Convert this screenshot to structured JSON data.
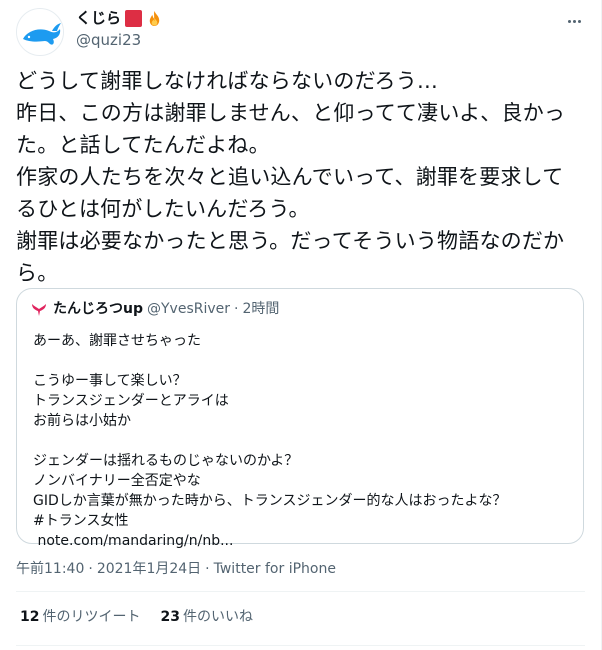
{
  "author": {
    "display_name": "くじら",
    "handle": "@quzi23"
  },
  "tweet": {
    "text": "どうして謝罪しなければならないのだろう…\n昨日、この方は謝罪しません、と仰ってて凄いよ、良かった。と話してたんだよね。\n作家の人たちを次々と追い込んでいって、謝罪を要求してるひとは何がしたいんだろう。\n謝罪は必要なかったと思う。だってそういう物語なのだから。"
  },
  "quote": {
    "display_name": "たんじろつup",
    "handle": "@YvesRiver",
    "separator": "·",
    "time": "2時間",
    "text": "あーあ、謝罪させちゃった\n\nこうゆー事して楽しい？\nトランスジェンダーとアライは\nお前らは小姑か\n\nジェンダーは揺れるものじゃないのかよ？\nノンバイナリー全否定やな\nGIDしか言葉が無かった時から、トランスジェンダー的な人はおったよな？\n#トランス女性\n note.com/mandaring/n/nb..."
  },
  "meta": {
    "time": "午前11:40",
    "sep": "·",
    "date": "2021年1月24日",
    "source": "Twitter for iPhone"
  },
  "stats": {
    "retweets_count": "12",
    "retweets_label": "件のリツイート",
    "likes_count": "23",
    "likes_label": "件のいいね"
  },
  "colors": {
    "text": "#0f1419",
    "secondary": "#536471",
    "border": "#cfd9de",
    "avatar_whale": "#1d9bf0",
    "emoji_red_square": "#dd2e44",
    "fire": "#f4900c"
  },
  "icons": {
    "more": "more-horizontal-icon",
    "avatar": "whale-avatar",
    "quote_avatar": "red-whale-tail-icon"
  }
}
